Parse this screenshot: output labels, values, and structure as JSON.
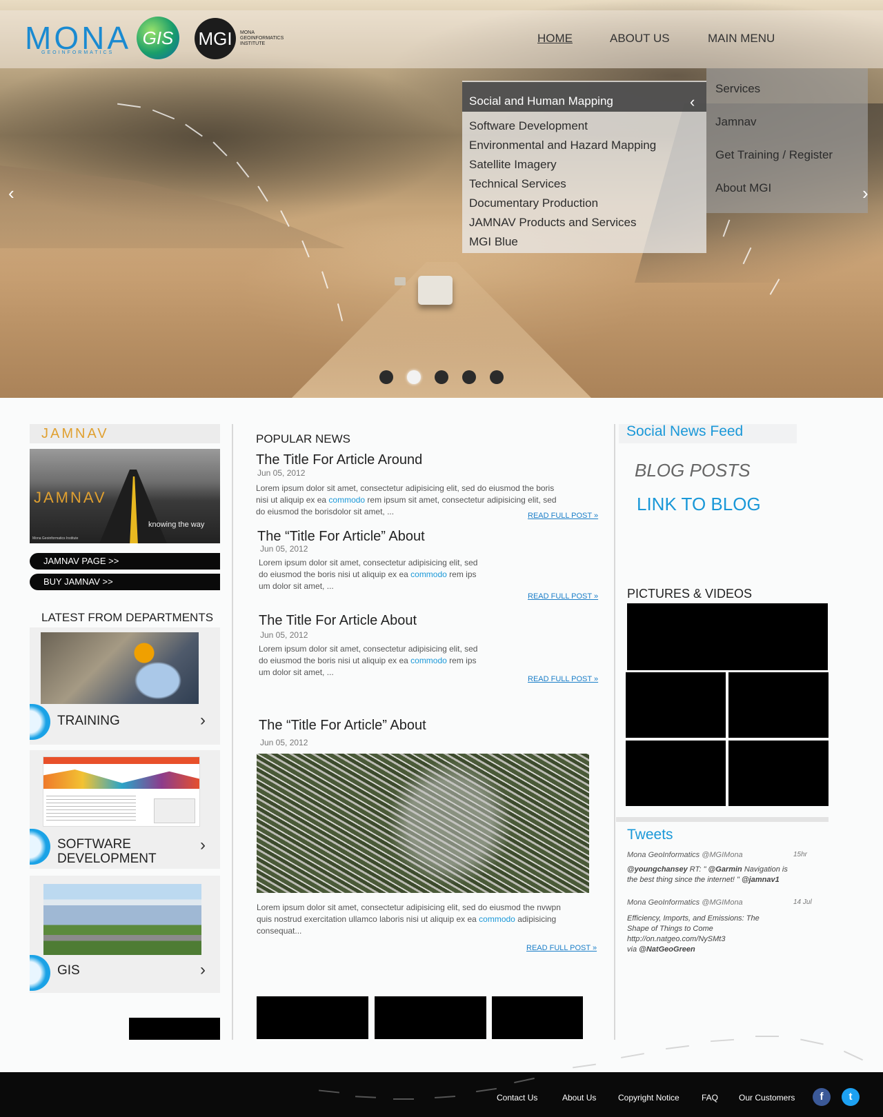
{
  "header": {
    "logo_mona": "MONA",
    "logo_sub": "GEOINFORMATICS",
    "logo_gis": "GIS",
    "logo_mgi": "MGI",
    "logo_mgi_text": "MONA GEOINFORMATICS INSTITUTE",
    "nav": [
      {
        "label": "HOME",
        "active": true
      },
      {
        "label": "ABOUT US"
      },
      {
        "label": "MAIN MENU"
      }
    ]
  },
  "menu": {
    "services_items": [
      "Social and Human Mapping",
      "Software Development",
      "Environmental  and Hazard Mapping",
      "Satellite Imagery",
      "Technical Services",
      "Documentary Production",
      "JAMNAV Products and Services",
      "MGI Blue"
    ],
    "main_items": [
      "Services",
      "Jamnav",
      "Get Training / Register",
      "About MGI"
    ]
  },
  "slider": {
    "slide_count": 5,
    "active_slide": 2
  },
  "left": {
    "jamnav_logo": "JAMNAV",
    "jamnav_img_logo": "JAMNAV",
    "jamnav_tagline": "knowing the way",
    "jamnav_footer": "Mona Geoinformatics Institute",
    "buttons": [
      "JAMNAV PAGE >>",
      "BUY JAMNAV >>"
    ],
    "departments_title": "LATEST FROM DEPARTMENTS",
    "departments": [
      "TRAINING",
      "SOFTWARE DEVELOPMENT",
      "GIS"
    ]
  },
  "center": {
    "section_title": "POPULAR NEWS",
    "articles": [
      {
        "title": "The Title For Article Around",
        "date": "Jun 05, 2012",
        "body1": "Lorem ipsum dolor sit amet, consectetur adipisicing elit, sed do eiusmod the boris",
        "body2a": "nisi ut aliquip ex ea ",
        "link": "commodo",
        "body2b": " rem ipsum sit amet, consectetur adipisicing elit, sed",
        "body3": "do eiusmod the borisdolor sit amet, ...",
        "read_more": "READ FULL POST »"
      },
      {
        "title": "The “Title For Article” About",
        "date": "Jun 05, 2012",
        "body1": "Lorem ipsum dolor sit amet, consectetur adipisicing elit, sed",
        "body2a": "do eiusmod the boris  nisi ut aliquip ex ea ",
        "link": "commodo",
        "body2b": " rem ips",
        "body3": "um dolor sit amet, ...",
        "read_more": "READ FULL POST »"
      },
      {
        "title": "The Title For Article About",
        "date": "Jun 05, 2012",
        "body1": "Lorem ipsum dolor sit amet, consectetur adipisicing elit, sed",
        "body2a": "do eiusmod the boris  nisi ut aliquip ex ea ",
        "link": "commodo",
        "body2b": " rem ips",
        "body3": "um dolor sit amet, ...",
        "read_more": "READ FULL POST »"
      },
      {
        "title": "The “Title For Article” About",
        "date": "Jun 05, 2012",
        "body1": "Lorem ipsum dolor sit amet, consectetur adipisicing elit, sed do eiusmod the nvwpn",
        "body2a": "quis nostrud exercitation ullamco laboris  nisi ut aliquip ex ea ",
        "link": "commodo",
        "body2b": " adipisicing",
        "body3": "consequat...",
        "read_more": "READ FULL POST »"
      }
    ]
  },
  "right": {
    "social_title": "Social News Feed",
    "blog_posts": "BLOG POSTS",
    "link_to_blog": "LINK TO BLOG",
    "pictures_title": "PICTURES & VIDEOS",
    "tweets_title": "Tweets",
    "tweets": [
      {
        "name": "Mona GeoInformatics",
        "handle": "@MGIMona",
        "time": "15hr",
        "line1_bold": "@youngchansey",
        "line1_rest": " RT: \" ",
        "line1_bold2": "@Garmin",
        "line1_end": " Navigation is",
        "line2": "the best thing since the internet! \" ",
        "line2_bold": "@jamnav1"
      },
      {
        "name": "Mona GeoInformatics",
        "handle": "@MGIMona",
        "time": "14 Jul",
        "line1": "Efficiency, Imports, and Emissions: The",
        "line2": "Shape of Things to Come",
        "line3": "http://on.natgeo.com/NySMt3",
        "line4_pre": "via ",
        "line4_bold": "@NatGeoGreen"
      }
    ]
  },
  "footer": {
    "links": [
      "Contact Us",
      "About Us",
      "Copyright Notice",
      "FAQ",
      "Our Customers"
    ],
    "facebook_glyph": "f",
    "twitter_glyph": "t"
  },
  "colors": {
    "accent": "#1a98d8",
    "footer_bg": "#0a0a0a",
    "facebook": "#3b5998",
    "twitter": "#1da1f2"
  }
}
